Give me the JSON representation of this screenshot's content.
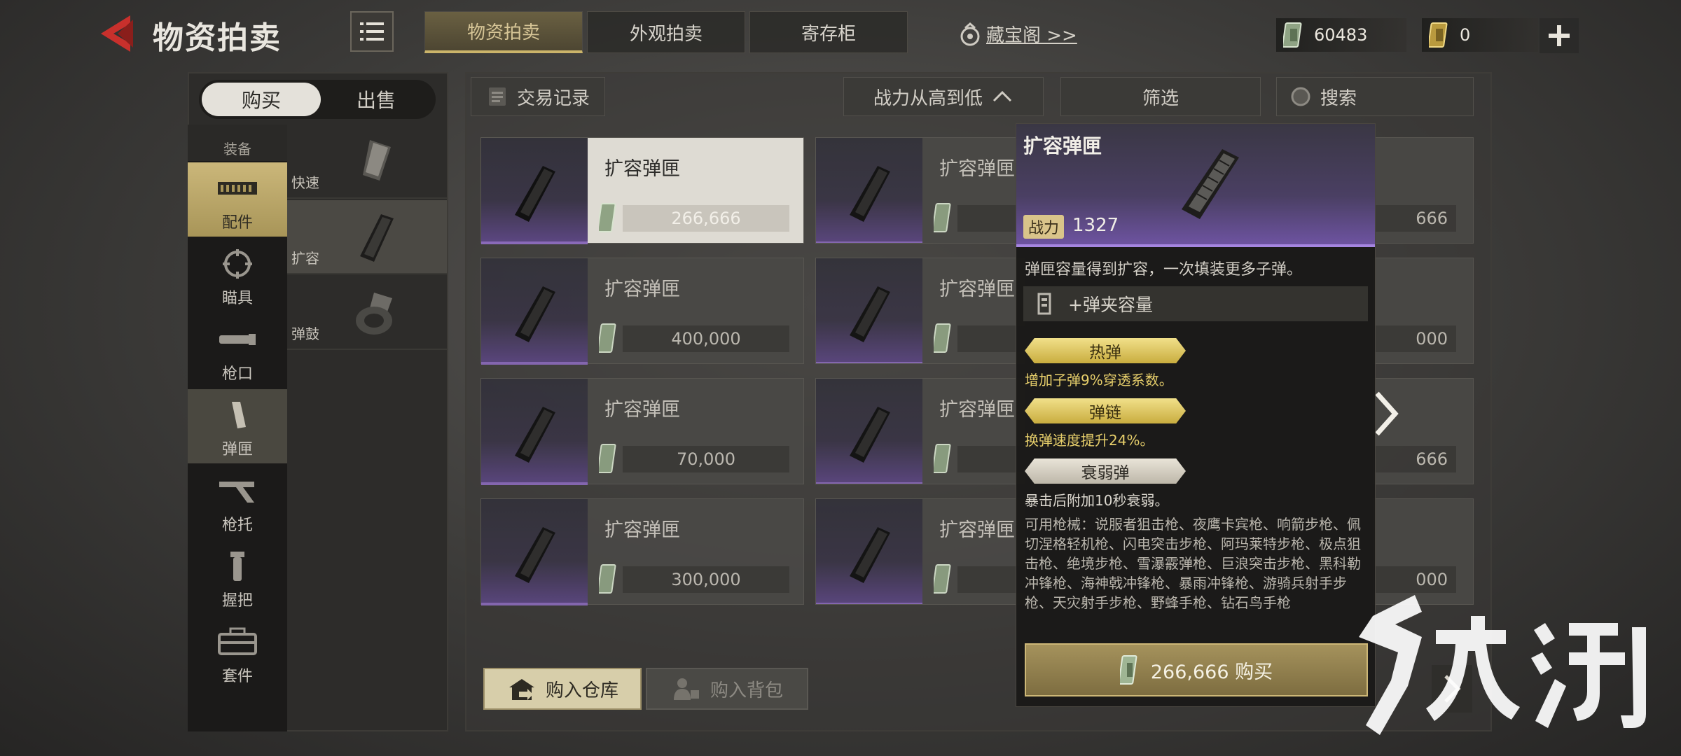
{
  "header": {
    "title": "物资拍卖",
    "tabs": [
      "物资拍卖",
      "外观拍卖",
      "寄存柜"
    ],
    "treasure_link": "藏宝阁 >>",
    "currency_cash": "60483",
    "currency_token": "0"
  },
  "left": {
    "buy": "购买",
    "sell": "出售",
    "top_category": "装备",
    "categories": [
      "配件",
      "瞄具",
      "枪口",
      "弹匣",
      "枪托",
      "握把",
      "套件"
    ],
    "subcategories": [
      "快速",
      "扩容",
      "弹鼓"
    ]
  },
  "toolbar": {
    "records": "交易记录",
    "sort": "战力从高到低",
    "filter": "筛选",
    "search": "搜索"
  },
  "items": [
    {
      "name": "扩容弹匣",
      "price": "266,666"
    },
    {
      "name": "扩容弹匣",
      "price": "400,000"
    },
    {
      "name": "扩容弹匣",
      "price": "70,000"
    },
    {
      "name": "扩容弹匣",
      "price": "300,000"
    }
  ],
  "items_col2": [
    "扩容弹匣",
    "扩容弹匣",
    "扩容弹匣",
    "扩容弹匣"
  ],
  "items_col3_prices": [
    "666",
    "000",
    "666",
    "000"
  ],
  "bottom": {
    "to_warehouse": "购入仓库",
    "to_backpack": "购入背包"
  },
  "tooltip": {
    "title": "扩容弹匣",
    "power_label": "战力",
    "power_value": "1327",
    "desc": "弹匣容量得到扩容，一次填装更多子弹。",
    "stat": "+弹夹容量",
    "perks": [
      {
        "name": "热弹",
        "desc": "增加子弹9%穿透系数。"
      },
      {
        "name": "弹链",
        "desc": "换弹速度提升24%。"
      },
      {
        "name": "衰弱弹",
        "desc": "暴击后附加10秒衰弱。"
      }
    ],
    "weapons": "可用枪械：说服者狙击枪、夜鹰卡宾枪、响箭步枪、佩切涅格轻机枪、闪电突击步枪、阿玛莱特步枪、极点狙击枪、绝境步枪、雪瀑霰弹枪、巨浪突击步枪、黑科勒冲锋枪、海神戟冲锋枪、暴雨冲锋枪、游骑兵射手步枪、天灾射手步枪、野蜂手枪、钻石鸟手枪",
    "buy_label": "266,666 购买"
  },
  "colors": {
    "accent_gold": "#cbb46a",
    "rarity_purple": "#8a6ab9",
    "back_red": "#c8302c"
  }
}
